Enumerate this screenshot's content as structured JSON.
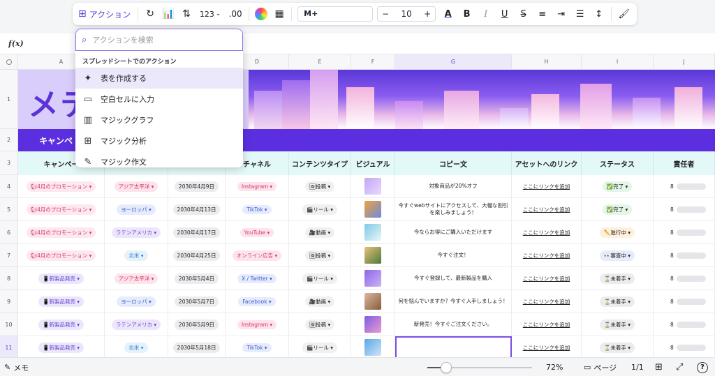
{
  "toolbar": {
    "action_label": "アクション",
    "number_format": "123",
    "decimal": ".00",
    "font_name": "M+",
    "font_size": "10",
    "minus": "−",
    "plus": "+"
  },
  "formula_bar": {
    "fx": "f(x)"
  },
  "action_menu": {
    "search_placeholder": "アクションを検索",
    "section_title": "スプレッドシートでのアクション",
    "items": [
      {
        "label": "表を作成する",
        "icon": "magic-wand-icon"
      },
      {
        "label": "空白セルに入力",
        "icon": "fill-cell-icon"
      },
      {
        "label": "マジックグラフ",
        "icon": "chart-icon"
      },
      {
        "label": "マジック分析",
        "icon": "grid-analysis-icon"
      },
      {
        "label": "マジック作文",
        "icon": "magic-pen-icon"
      }
    ]
  },
  "columns": [
    "A",
    "B",
    "C",
    "D",
    "E",
    "F",
    "G",
    "H",
    "I",
    "J"
  ],
  "rows": [
    "1",
    "2",
    "3",
    "4",
    "5",
    "6",
    "7",
    "8",
    "9",
    "10",
    "11"
  ],
  "banner": {
    "title": "メテ"
  },
  "row2_text": "キャンペ",
  "headers": [
    "キャンペー",
    "",
    "",
    "チャネル",
    "コンテンツタイプ",
    "ビジュアル",
    "コピー文",
    "アセットへのリンク",
    "ステータス",
    "責任者"
  ],
  "data_rows": [
    {
      "campaign": "🐿4月のプロモーション ▾",
      "region": "アジア太平洋 ▾",
      "date": "2030年4月9日",
      "channel": "Instagram ▾",
      "content": "🖼投稿 ▾",
      "copy": "対象商品が20%オフ",
      "link": "ここにリンクを追加",
      "status": "✅完了 ▾",
      "owner": "8"
    },
    {
      "campaign": "🐿4月のプロモーション ▾",
      "region": "ヨーロッパ ▾",
      "date": "2030年4月13日",
      "channel": "TikTok ▾",
      "content": "🎬リール ▾",
      "copy": "今すぐwebサイトにアクセスして、大幅な割引を楽しみましょう！",
      "link": "ここにリンクを追加",
      "status": "✅完了 ▾",
      "owner": "8"
    },
    {
      "campaign": "🐿4月のプロモーション ▾",
      "region": "ラテンアメリカ ▾",
      "date": "2030年4月17日",
      "channel": "YouTube ▾",
      "content": "🎥動画 ▾",
      "copy": "今ならお得にご購入いただけます",
      "link": "ここにリンクを追加",
      "status": "✏️進行中 ▾",
      "owner": "8"
    },
    {
      "campaign": "🐿4月のプロモーション ▾",
      "region": "北米 ▾",
      "date": "2030年4月25日",
      "channel": "オンライン広告 ▾",
      "content": "🖼投稿 ▾",
      "copy": "今すぐ注文！",
      "link": "ここにリンクを追加",
      "status": "👀審査中 ▾",
      "owner": "8"
    },
    {
      "campaign": "📱新製品発売 ▾",
      "region": "アジア太平洋 ▾",
      "date": "2030年5月4日",
      "channel": "X / Twitter ▾",
      "content": "🎬リール ▾",
      "copy": "今すぐ登録して、最新製品を購入",
      "link": "ここにリンクを追加",
      "status": "⌛未着手 ▾",
      "owner": "8"
    },
    {
      "campaign": "📱新製品発売 ▾",
      "region": "ヨーロッパ ▾",
      "date": "2030年5月7日",
      "channel": "Facebook ▾",
      "content": "🎥動画 ▾",
      "copy": "何を悩んでいますか？今すぐ入手しましょう！",
      "link": "ここにリンクを追加",
      "status": "⌛未着手 ▾",
      "owner": "8"
    },
    {
      "campaign": "📱新製品発売 ▾",
      "region": "ラテンアメリカ ▾",
      "date": "2030年5月9日",
      "channel": "Instagram ▾",
      "content": "🖼投稿 ▾",
      "copy": "新発売！今すぐご注文ください。",
      "link": "ここにリンクを追加",
      "status": "⌛未着手 ▾",
      "owner": "8"
    },
    {
      "campaign": "📱新製品発売 ▾",
      "region": "北米 ▾",
      "date": "2030年5月18日",
      "channel": "TikTok ▾",
      "content": "🎬リール ▾",
      "copy": "",
      "link": "ここにリンクを追加",
      "status": "⌛未着手 ▾",
      "owner": "8"
    }
  ],
  "statusbar": {
    "notes": "メモ",
    "zoom": "72%",
    "zoom_level": 0.18,
    "pages_label": "ページ",
    "page_count": "1/1",
    "help": "?"
  },
  "colors": {
    "accent": "#5b3fd6",
    "header_band": "#5b2fe0",
    "header_row": "#e3f8f8"
  }
}
